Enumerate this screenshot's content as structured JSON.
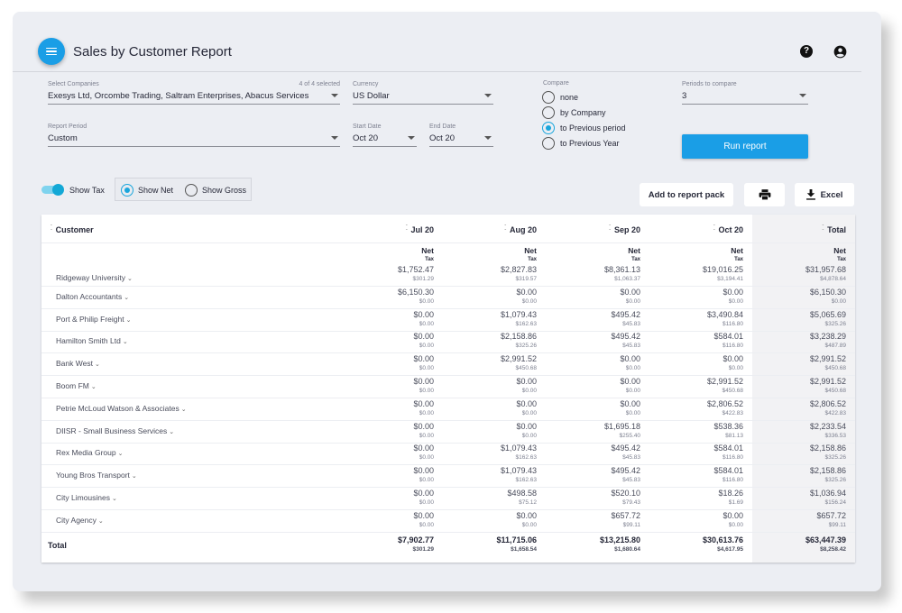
{
  "header": {
    "title": "Sales by Customer Report",
    "menu_icon": "hamburger-menu-icon",
    "help_icon": "help-circle-icon",
    "help_glyph": "?",
    "account_icon": "account-circle-icon"
  },
  "filters": {
    "companies": {
      "label": "Select Companies",
      "value": "Exesys Ltd, Orcombe Trading, Saltram Enterprises, Abacus Services",
      "meta": "4 of 4 selected"
    },
    "currency": {
      "label": "Currency",
      "value": "US Dollar"
    },
    "report_period": {
      "label": "Report Period",
      "value": "Custom"
    },
    "start_date": {
      "label": "Start Date",
      "value": "Oct 20"
    },
    "end_date": {
      "label": "End Date",
      "value": "Oct 20"
    },
    "compare": {
      "label": "Compare",
      "options": [
        "none",
        "by Company",
        "to Previous period",
        "to Previous Year"
      ],
      "selected": "to Previous period"
    },
    "periods_to_compare": {
      "label": "Periods to compare",
      "value": "3"
    },
    "run_button": "Run report"
  },
  "view_options": {
    "show_tax": {
      "label": "Show Tax",
      "on": true
    },
    "net_gross": {
      "options": [
        "Show Net",
        "Show Gross"
      ],
      "selected": "Show Net"
    }
  },
  "actions": {
    "add_to_pack": "Add to report pack",
    "print_icon": "printer-icon",
    "excel": "Excel",
    "excel_icon": "download-icon"
  },
  "table": {
    "customer_header": "Customer",
    "columns": [
      "Jul 20",
      "Aug 20",
      "Sep 20",
      "Oct 20",
      "Total"
    ],
    "net_label": "Net",
    "tax_label": "Tax",
    "rows": [
      {
        "customer": "Ridgeway University",
        "net": [
          "$1,752.47",
          "$2,827.83",
          "$8,361.13",
          "$19,016.25",
          "$31,957.68"
        ],
        "tax": [
          "$301.29",
          "$319.57",
          "$1,063.37",
          "$3,194.41",
          "$4,878.64"
        ]
      },
      {
        "customer": "Dalton Accountants",
        "net": [
          "$6,150.30",
          "$0.00",
          "$0.00",
          "$0.00",
          "$6,150.30"
        ],
        "tax": [
          "$0.00",
          "$0.00",
          "$0.00",
          "$0.00",
          "$0.00"
        ]
      },
      {
        "customer": "Port & Philip Freight",
        "net": [
          "$0.00",
          "$1,079.43",
          "$495.42",
          "$3,490.84",
          "$5,065.69"
        ],
        "tax": [
          "$0.00",
          "$162.63",
          "$45.83",
          "$116.80",
          "$325.26"
        ]
      },
      {
        "customer": "Hamilton Smith Ltd",
        "net": [
          "$0.00",
          "$2,158.86",
          "$495.42",
          "$584.01",
          "$3,238.29"
        ],
        "tax": [
          "$0.00",
          "$325.26",
          "$45.83",
          "$116.80",
          "$487.89"
        ]
      },
      {
        "customer": "Bank West",
        "net": [
          "$0.00",
          "$2,991.52",
          "$0.00",
          "$0.00",
          "$2,991.52"
        ],
        "tax": [
          "$0.00",
          "$450.68",
          "$0.00",
          "$0.00",
          "$450.68"
        ]
      },
      {
        "customer": "Boom FM",
        "net": [
          "$0.00",
          "$0.00",
          "$0.00",
          "$2,991.52",
          "$2,991.52"
        ],
        "tax": [
          "$0.00",
          "$0.00",
          "$0.00",
          "$450.68",
          "$450.68"
        ]
      },
      {
        "customer": "Petrie McLoud Watson & Associates",
        "net": [
          "$0.00",
          "$0.00",
          "$0.00",
          "$2,806.52",
          "$2,806.52"
        ],
        "tax": [
          "$0.00",
          "$0.00",
          "$0.00",
          "$422.83",
          "$422.83"
        ]
      },
      {
        "customer": "DIISR - Small Business Services",
        "net": [
          "$0.00",
          "$0.00",
          "$1,695.18",
          "$538.36",
          "$2,233.54"
        ],
        "tax": [
          "$0.00",
          "$0.00",
          "$255.40",
          "$81.13",
          "$336.53"
        ]
      },
      {
        "customer": "Rex Media Group",
        "net": [
          "$0.00",
          "$1,079.43",
          "$495.42",
          "$584.01",
          "$2,158.86"
        ],
        "tax": [
          "$0.00",
          "$162.63",
          "$45.83",
          "$116.80",
          "$325.26"
        ]
      },
      {
        "customer": "Young Bros Transport",
        "net": [
          "$0.00",
          "$1,079.43",
          "$495.42",
          "$584.01",
          "$2,158.86"
        ],
        "tax": [
          "$0.00",
          "$162.63",
          "$45.83",
          "$116.80",
          "$325.26"
        ]
      },
      {
        "customer": "City Limousines",
        "net": [
          "$0.00",
          "$498.58",
          "$520.10",
          "$18.26",
          "$1,036.94"
        ],
        "tax": [
          "$0.00",
          "$75.12",
          "$79.43",
          "$1.69",
          "$156.24"
        ]
      },
      {
        "customer": "City Agency",
        "net": [
          "$0.00",
          "$0.00",
          "$657.72",
          "$0.00",
          "$657.72"
        ],
        "tax": [
          "$0.00",
          "$0.00",
          "$99.11",
          "$0.00",
          "$99.11"
        ]
      }
    ],
    "total": {
      "label": "Total",
      "net": [
        "$7,902.77",
        "$11,715.06",
        "$13,215.80",
        "$30,613.76",
        "$63,447.39"
      ],
      "tax": [
        "$301.29",
        "$1,658.54",
        "$1,680.64",
        "$4,617.95",
        "$8,258.42"
      ]
    }
  }
}
